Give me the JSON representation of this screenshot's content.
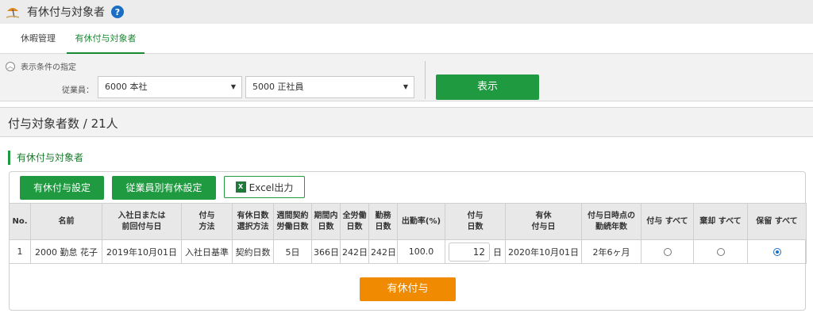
{
  "app": {
    "title": "有休付与対象者",
    "icon": "beach-umbrella-icon",
    "help_icon": "question-circle-icon",
    "help_glyph": "?"
  },
  "tabs": [
    {
      "label": "休暇管理",
      "active": false
    },
    {
      "label": "有休付与対象者",
      "active": true
    }
  ],
  "filter": {
    "heading": "表示条件の指定",
    "collapse_icon": "chevron-up-icon",
    "employee_label": "従業員：",
    "company_value": "6000 本社",
    "employment_type_value": "5000 正社員",
    "show_button": "表示"
  },
  "summary": {
    "count_text": "付与対象者数 / 21人"
  },
  "section": {
    "title": "有休付与対象者"
  },
  "toolbar": {
    "grant_settings": "有休付与設定",
    "per_employee_settings": "従業員別有休設定",
    "excel_export": "Excel出力",
    "excel_icon": "excel-icon",
    "excel_glyph": "X"
  },
  "table": {
    "headers": {
      "no": "No.",
      "name": "名前",
      "join_date_1": "入社日または",
      "join_date_2": "前回付与日",
      "grant_method_1": "付与",
      "grant_method_2": "方法",
      "days_method_1": "有休日数",
      "days_method_2": "選択方法",
      "weekly_1": "週間契約",
      "weekly_2": "労働日数",
      "period_1": "期間内",
      "period_2": "日数",
      "full_1": "全労働",
      "full_2": "日数",
      "work_1": "勤務",
      "work_2": "日数",
      "attendance": "出勤率(%)",
      "grant_days_1": "付与",
      "grant_days_2": "日数",
      "grant_date_1": "有休",
      "grant_date_2": "付与日",
      "tenure_1": "付与日時点の",
      "tenure_2": "勤続年数",
      "grant_col": "付与",
      "reject_col": "棄却",
      "hold_col": "保留",
      "all_label": "すべて"
    },
    "rows": [
      {
        "no": "1",
        "name": "2000 勤怠 花子",
        "join_date": "2019年10月01日",
        "grant_method": "入社日基準",
        "days_method": "契約日数",
        "weekly_days": "5日",
        "period_days": "366日",
        "full_work_days": "242日",
        "work_days": "242日",
        "attendance_rate": "100.0",
        "grant_days": "12",
        "grant_days_unit": "日",
        "grant_date": "2020年10月01日",
        "tenure": "2年6ヶ月",
        "selection": "hold"
      }
    ]
  },
  "actions": {
    "grant_button": "有休付与"
  },
  "colors": {
    "primary_green": "#1f9a40",
    "grant_orange": "#f08a00",
    "help_blue": "#1a6fc4"
  }
}
